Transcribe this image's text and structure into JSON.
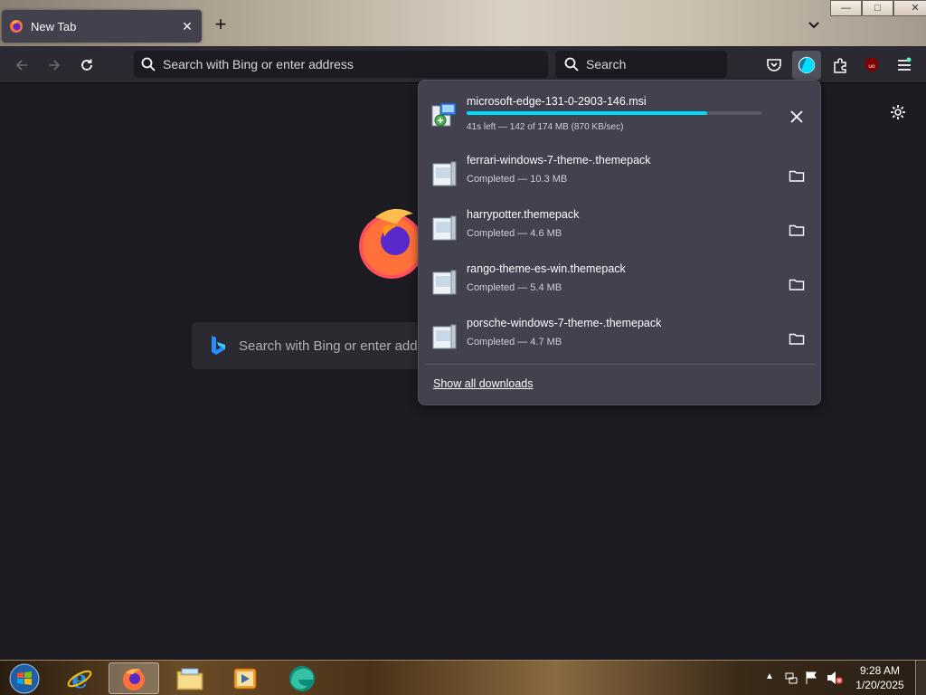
{
  "window": {
    "tab_title": "New Tab",
    "controls": {
      "minimize": "—",
      "maximize": "□",
      "close": "✕"
    }
  },
  "navbar": {
    "url_placeholder": "Search with Bing or enter address",
    "search_placeholder": "Search"
  },
  "home": {
    "search_placeholder": "Search with Bing or enter add"
  },
  "downloads": {
    "active": {
      "filename": "microsoft-edge-131-0-2903-146.msi",
      "status": "41s left — 142 of 174 MB (870 KB/sec)",
      "progress_fraction": 0.816
    },
    "items": [
      {
        "filename": "ferrari-windows-7-theme-.themepack",
        "status": "Completed — 10.3 MB"
      },
      {
        "filename": "harrypotter.themepack",
        "status": "Completed — 4.6 MB"
      },
      {
        "filename": "rango-theme-es-win.themepack",
        "status": "Completed — 5.4 MB"
      },
      {
        "filename": "porsche-windows-7-theme-.themepack",
        "status": "Completed — 4.7 MB"
      }
    ],
    "show_all": "Show all downloads"
  },
  "taskbar": {
    "apps": [
      "start-orb",
      "internet-explorer",
      "firefox",
      "file-explorer",
      "media-player",
      "edge"
    ],
    "time": "9:28 AM",
    "date": "1/20/2025"
  },
  "colors": {
    "accent": "#00ddff",
    "panel": "#42414d",
    "toolbar": "#2b2a33",
    "content": "#1c1b22"
  }
}
